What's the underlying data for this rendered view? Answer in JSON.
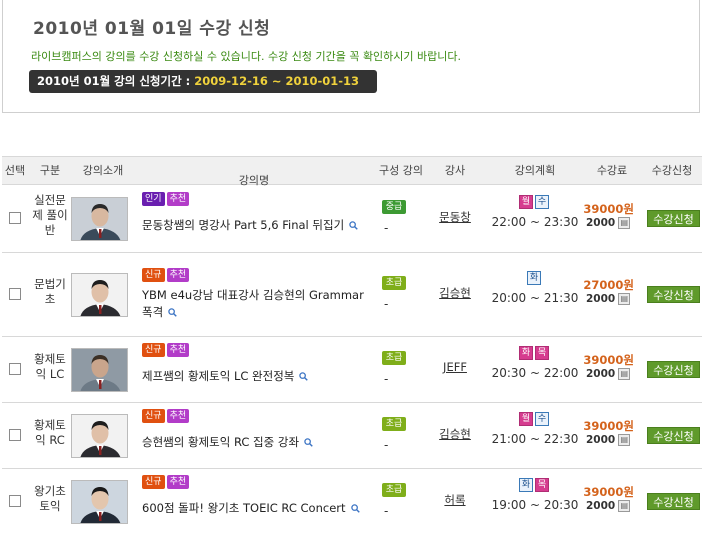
{
  "notice": {
    "title": "2010년  01월  01일  수강 신청",
    "description": "라이브캠퍼스의 강의를 수강 신청하실 수 있습니다. 수강 신청 기간을 꼭 확인하시기 바랍니다.",
    "period_label": "2010년 01월 강의 신청기간 : ",
    "period_dates": "2009-12-16 ~ 2010-01-13"
  },
  "table": {
    "headers": {
      "select": "선택",
      "category": "구분",
      "intro": "강의소개",
      "name": "강의명",
      "composition": "구성 강의",
      "teacher": "강사",
      "schedule": "강의계획",
      "fee": "수강료",
      "apply": "수강신청"
    },
    "rows": [
      {
        "category": [
          "실전문",
          "제 풀이",
          "반"
        ],
        "badges": [
          {
            "text": "인기",
            "kind": "hot"
          },
          {
            "text": "추천",
            "kind": "rec"
          }
        ],
        "title": "문동창쌤의 명강사 Part 5,6 Final 뒤집기",
        "level": "중급",
        "composition": "-",
        "teacher": "문동창",
        "days": [
          {
            "text": "월",
            "on": true
          },
          {
            "text": "수",
            "on": false
          }
        ],
        "time": "22:00 ~ 23:30",
        "price": "39000원",
        "price_sub": "2000",
        "apply_label": "수강신청"
      },
      {
        "category": [
          "문법기",
          "초"
        ],
        "badges": [
          {
            "text": "신규",
            "kind": "new"
          },
          {
            "text": "추천",
            "kind": "rec"
          }
        ],
        "title": "YBM e4u강남 대표강사 김승현의 Grammar 폭격",
        "level": "초급",
        "composition": "-",
        "teacher": "김승현",
        "days": [
          {
            "text": "화",
            "on": false
          }
        ],
        "time": "20:00 ~ 21:30",
        "price": "27000원",
        "price_sub": "2000",
        "apply_label": "수강신청"
      },
      {
        "category": [
          "황제토",
          "익 LC"
        ],
        "badges": [
          {
            "text": "신규",
            "kind": "new"
          },
          {
            "text": "추천",
            "kind": "rec"
          }
        ],
        "title": "제프쌤의 황제토익 LC 완전정복",
        "level": "초급",
        "composition": "-",
        "teacher": "JEFF",
        "days": [
          {
            "text": "화",
            "on": true
          },
          {
            "text": "목",
            "on": true
          }
        ],
        "time": "20:30 ~ 22:00",
        "price": "39000원",
        "price_sub": "2000",
        "apply_label": "수강신청"
      },
      {
        "category": [
          "황제토",
          "익 RC"
        ],
        "badges": [
          {
            "text": "신규",
            "kind": "new"
          },
          {
            "text": "추천",
            "kind": "rec"
          }
        ],
        "title": "승현쌤의 황제토익 RC 집중 강좌",
        "level": "초급",
        "composition": "-",
        "teacher": "김승현",
        "days": [
          {
            "text": "월",
            "on": true
          },
          {
            "text": "수",
            "on": false
          }
        ],
        "time": "21:00 ~ 22:30",
        "price": "39000원",
        "price_sub": "2000",
        "apply_label": "수강신청"
      },
      {
        "category": [
          "왕기초",
          "토익"
        ],
        "badges": [
          {
            "text": "신규",
            "kind": "new"
          },
          {
            "text": "추천",
            "kind": "rec"
          }
        ],
        "title": "600점 돌파! 왕기초 TOEIC RC Concert",
        "level": "초급",
        "composition": "-",
        "teacher": "허록",
        "days": [
          {
            "text": "화",
            "on": false
          },
          {
            "text": "목",
            "on": true
          }
        ],
        "time": "19:00 ~ 20:30",
        "price": "39000원",
        "price_sub": "2000",
        "apply_label": "수강신청"
      }
    ]
  },
  "icons": {
    "search": "magnifier-icon",
    "ebook": "book-icon"
  },
  "colors": {
    "accent_green": "#5f9a2b",
    "price_orange": "#d4631c",
    "period_yellow": "#f0d23c",
    "notice_green": "#3a8a12"
  }
}
